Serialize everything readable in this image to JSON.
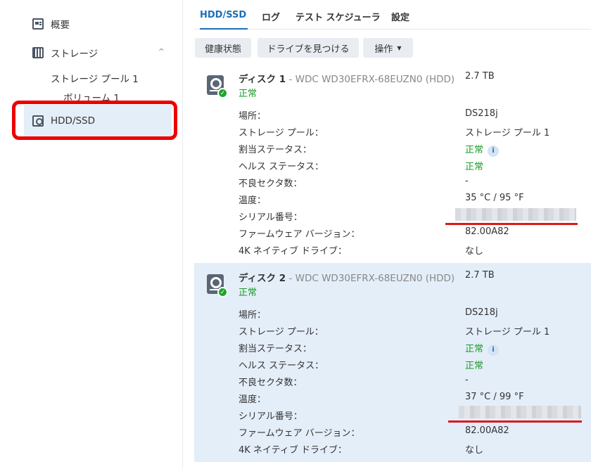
{
  "sidebar": {
    "overview": "概要",
    "storage": "ストレージ",
    "storage_pool": "ストレージ プール 1",
    "volume": "ボリューム 1",
    "hdd_ssd": "HDD/SSD"
  },
  "tabs": [
    "HDD/SSD",
    "ログ",
    "テスト スケジューラ",
    "設定"
  ],
  "toolbar": {
    "health": "健康状態",
    "locate": "ドライブを見つける",
    "action": "操作"
  },
  "labels": {
    "location": "場所：",
    "storage_pool": "ストレージ プール：",
    "allocation_status": "割当ステータス：",
    "health_status": "ヘルス ステータス：",
    "bad_sectors": "不良セクタ数：",
    "temperature": "温度：",
    "serial": "シリアル番号：",
    "firmware": "ファームウェア バージョン：",
    "native_4k": "4K ネイティブ ドライブ："
  },
  "disks": [
    {
      "name": "ディスク 1",
      "model": " - WDC WD30EFRX-68EUZN0 (HDD)",
      "size": "2.7 TB",
      "status": "正常",
      "location": "DS218j",
      "storage_pool": "ストレージ プール 1",
      "allocation_status": "正常",
      "health_status": "正常",
      "bad_sectors": "-",
      "temperature": "35 °C / 95 °F",
      "firmware": "82.00A82",
      "native_4k": "なし"
    },
    {
      "name": "ディスク 2",
      "model": " - WDC WD30EFRX-68EUZN0 (HDD)",
      "size": "2.7 TB",
      "status": "正常",
      "location": "DS218j",
      "storage_pool": "ストレージ プール 1",
      "allocation_status": "正常",
      "health_status": "正常",
      "bad_sectors": "-",
      "temperature": "37 °C / 99 °F",
      "firmware": "82.00A82",
      "native_4k": "なし"
    }
  ],
  "icons": {
    "info": "i",
    "check": "✓",
    "caret": "▼",
    "chevron": "^"
  },
  "colors": {
    "accent": "#1f6fb8",
    "ok_green": "#1a9a27",
    "selected_bg": "#e4eef9",
    "annotation_red": "#ee0000"
  }
}
